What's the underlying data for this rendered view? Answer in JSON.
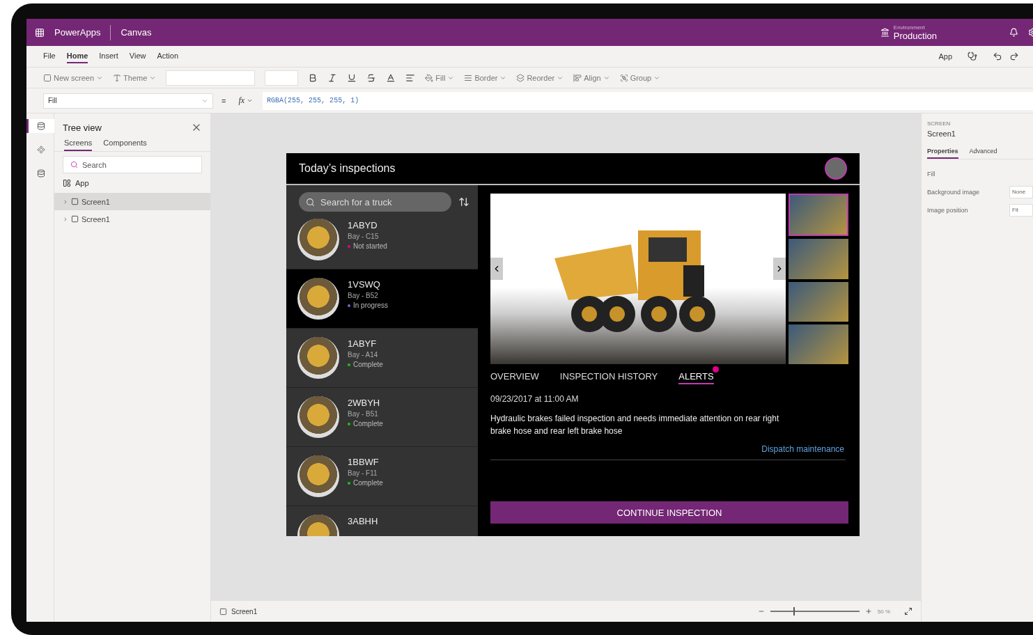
{
  "app_bar": {
    "product": "PowerApps",
    "mode": "Canvas",
    "environment_label": "Environment",
    "environment": "Production"
  },
  "menu_tabs": [
    {
      "label": "File",
      "selected": false
    },
    {
      "label": "Home",
      "selected": true
    },
    {
      "label": "Insert",
      "selected": false
    },
    {
      "label": "View",
      "selected": false
    },
    {
      "label": "Action",
      "selected": false
    }
  ],
  "menu_right": {
    "app_label": "App"
  },
  "toolbar": {
    "text_tools": [
      "New screen",
      "Theme"
    ],
    "arrange_tools": [
      "Fill",
      "Border",
      "Reorder",
      "Align",
      "Group"
    ]
  },
  "formula_bar": {
    "property": "Fill",
    "operator": "=",
    "fx": "fx",
    "formula": "RGBA(255, 255, 255, 1)"
  },
  "tree_view": {
    "title": "Tree view",
    "tabs": [
      {
        "label": "Screens",
        "selected": true
      },
      {
        "label": "Components",
        "selected": false
      }
    ],
    "search": {
      "placeholder": "Search"
    },
    "app_item": "App",
    "items": [
      {
        "label": "Screen1",
        "selected": true,
        "expanded": false
      },
      {
        "label": "Screen1",
        "selected": false,
        "expanded": false
      }
    ]
  },
  "preview": {
    "title": "Today’s inspections",
    "search": {
      "placeholder": "Search for a truck"
    },
    "trucks": [
      {
        "id": "1ABYD",
        "bay": "Bay - C15",
        "status": "Not started",
        "color": "#e3008c",
        "selected": false
      },
      {
        "id": "1VSWQ",
        "bay": "Bay - B52",
        "status": "In progress",
        "color": "#6b69d6",
        "selected": true
      },
      {
        "id": "1ABYF",
        "bay": "Bay - A14",
        "status": "Complete",
        "color": "#16c60c",
        "selected": false
      },
      {
        "id": "2WBYH",
        "bay": "Bay - B51",
        "status": "Complete",
        "color": "#16c60c",
        "selected": false
      },
      {
        "id": "1BBWF",
        "bay": "Bay - F11",
        "status": "Complete",
        "color": "#16c60c",
        "selected": false
      },
      {
        "id": "3ABHH",
        "selected": false
      }
    ],
    "thumbnails": [
      {
        "selected": true
      },
      {
        "selected": false
      },
      {
        "selected": false
      },
      {
        "selected": false
      }
    ],
    "tabs": [
      {
        "label": "OVERVIEW",
        "selected": false,
        "alert": false
      },
      {
        "label": "INSPECTION HISTORY",
        "selected": false,
        "alert": false
      },
      {
        "label": "ALERTS",
        "selected": true,
        "alert": true
      }
    ],
    "date": "09/23/2017 at 11:00 AM",
    "description": "Hydraulic brakes failed inspection and needs immediate attention on rear right brake hose and rear left brake hose",
    "link": "Dispatch maintenance",
    "button": "CONTINUE INSPECTION"
  },
  "properties": {
    "kind_label": "SCREEN",
    "name": "Screen1",
    "tabs": [
      {
        "label": "Properties",
        "selected": true
      },
      {
        "label": "Advanced",
        "selected": false
      }
    ],
    "rows": [
      {
        "label": "Fill"
      },
      {
        "label": "Background image",
        "value": "None"
      },
      {
        "label": "Image position",
        "value": "Fit"
      }
    ]
  },
  "status_bar": {
    "screen": "Screen1",
    "zoom": {
      "level": 0.26,
      "reading": "50 %"
    }
  }
}
